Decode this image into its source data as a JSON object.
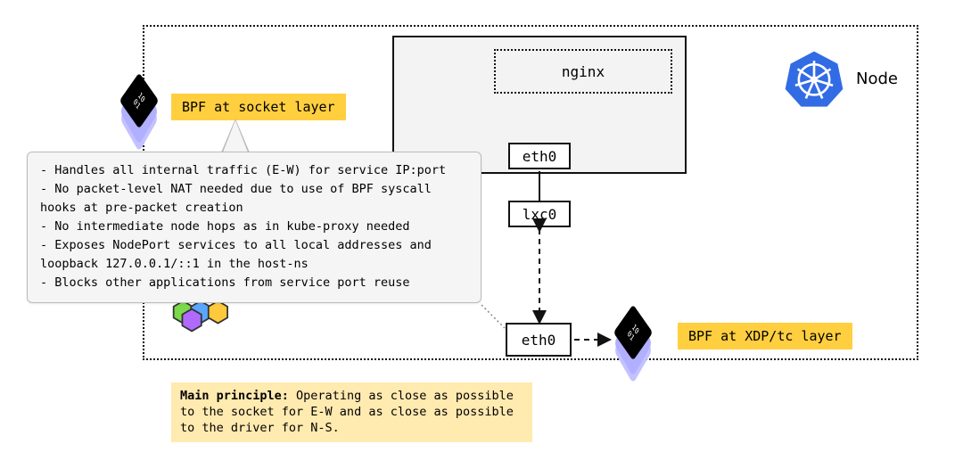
{
  "outer": {
    "label": "Node"
  },
  "inner": {
    "app_label": "nginx",
    "if_top": "eth0"
  },
  "lxc_label": "lxc0",
  "if_bottom": "eth0",
  "tags": {
    "socket": "BPF at socket layer",
    "xdp": "BPF at XDP/tc layer"
  },
  "callout": {
    "lines": [
      "- Handles all internal traffic (E-W) for service IP:port",
      "- No packet-level NAT needed due to use of BPF syscall",
      "  hooks at pre-packet creation",
      "- No intermediate node hops as in kube-proxy needed",
      "- Exposes NodePort services to all local addresses and",
      "  loopback 127.0.0.1/::1 in the host-ns",
      "- Blocks other applications from service port reuse"
    ]
  },
  "note": {
    "bold": "Main principle:",
    "rest": " Operating as close as possible to the socket for E-W and as close as possible to the driver for N-S."
  },
  "icons": {
    "ebpf_glyph": "10\n01"
  }
}
